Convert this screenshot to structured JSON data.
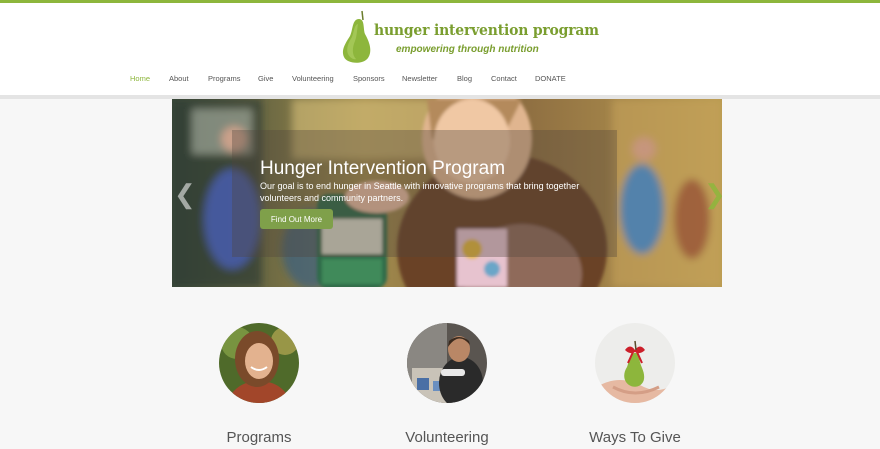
{
  "logo": {
    "title": "hunger intervention program",
    "tagline": "empowering through nutrition"
  },
  "nav": {
    "items": [
      {
        "label": "Home",
        "active": true
      },
      {
        "label": "About"
      },
      {
        "label": "Programs"
      },
      {
        "label": "Give"
      },
      {
        "label": "Volunteering"
      },
      {
        "label": "Sponsors"
      },
      {
        "label": "Newsletter"
      },
      {
        "label": "Blog"
      },
      {
        "label": "Contact"
      },
      {
        "label": "DONATE"
      }
    ]
  },
  "hero": {
    "title": "Hunger Intervention Program",
    "text": "Our goal is to end hunger in Seattle with innovative programs that bring together volunteers and community partners.",
    "button_label": "Find Out More",
    "prev_icon": "chevron-left-icon",
    "next_icon": "chevron-right-icon"
  },
  "features": [
    {
      "label": "Programs",
      "image": "smiling-girl-photo"
    },
    {
      "label": "Volunteering",
      "image": "volunteer-packing-photo"
    },
    {
      "label": "Ways To Give",
      "image": "pear-gift-photo"
    }
  ],
  "colors": {
    "accent": "#8db63c",
    "button": "#7fa04a",
    "text": "#555555"
  }
}
